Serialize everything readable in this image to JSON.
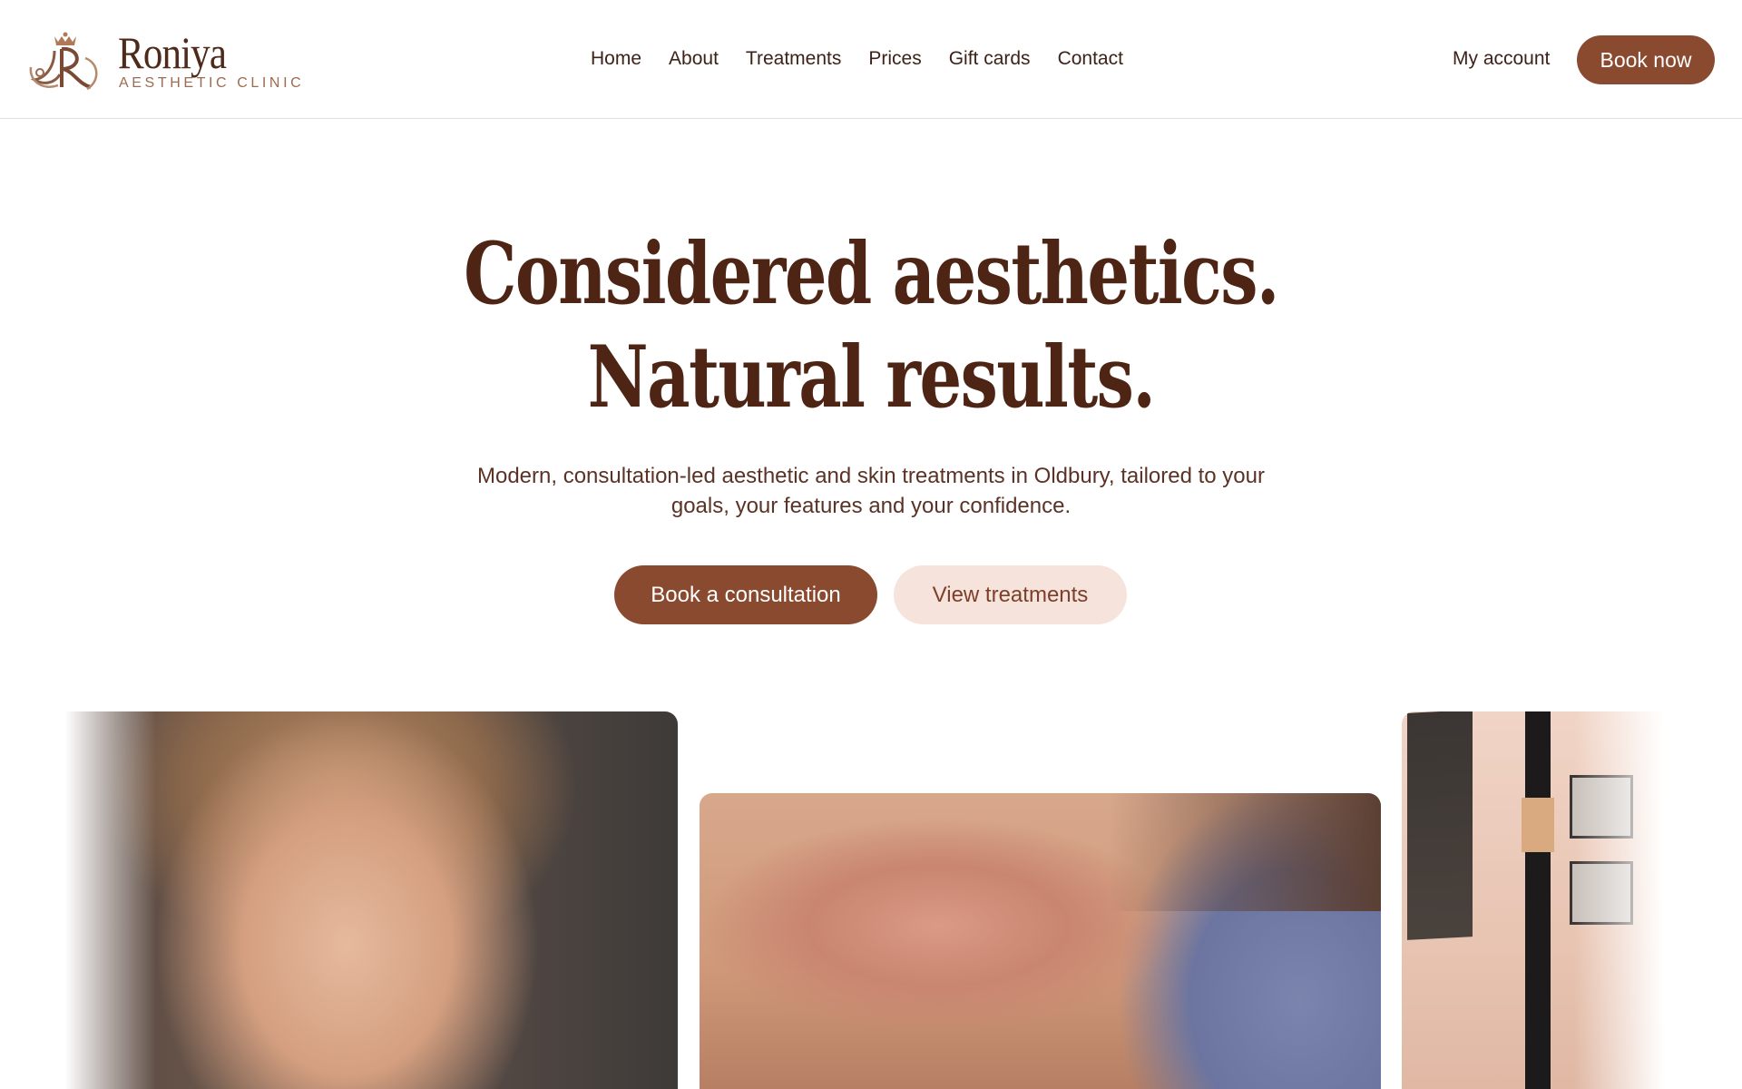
{
  "brand": {
    "name": "Roniya",
    "tagline": "AESTHETIC CLINIC"
  },
  "nav": {
    "items": [
      {
        "label": "Home"
      },
      {
        "label": "About"
      },
      {
        "label": "Treatments"
      },
      {
        "label": "Prices"
      },
      {
        "label": "Gift cards"
      },
      {
        "label": "Contact"
      }
    ],
    "my_account": "My account",
    "book_now": "Book now"
  },
  "hero": {
    "title_line1": "Considered aesthetics.",
    "title_line2": "Natural results.",
    "subtitle": "Modern, consultation-led aesthetic and skin treatments in Oldbury, tailored to your goals, your features and your confidence.",
    "primary_cta": "Book a consultation",
    "secondary_cta": "View treatments"
  },
  "gallery": {
    "images": [
      {
        "subject": "forehead-markings-treatment-photo"
      },
      {
        "subject": "lip-filler-injection-photo"
      },
      {
        "subject": "clinic-interior-photo"
      }
    ]
  },
  "colors": {
    "accent": "#8a4a2f",
    "accent_soft": "#f6e3dc",
    "heading": "#4e2414"
  }
}
